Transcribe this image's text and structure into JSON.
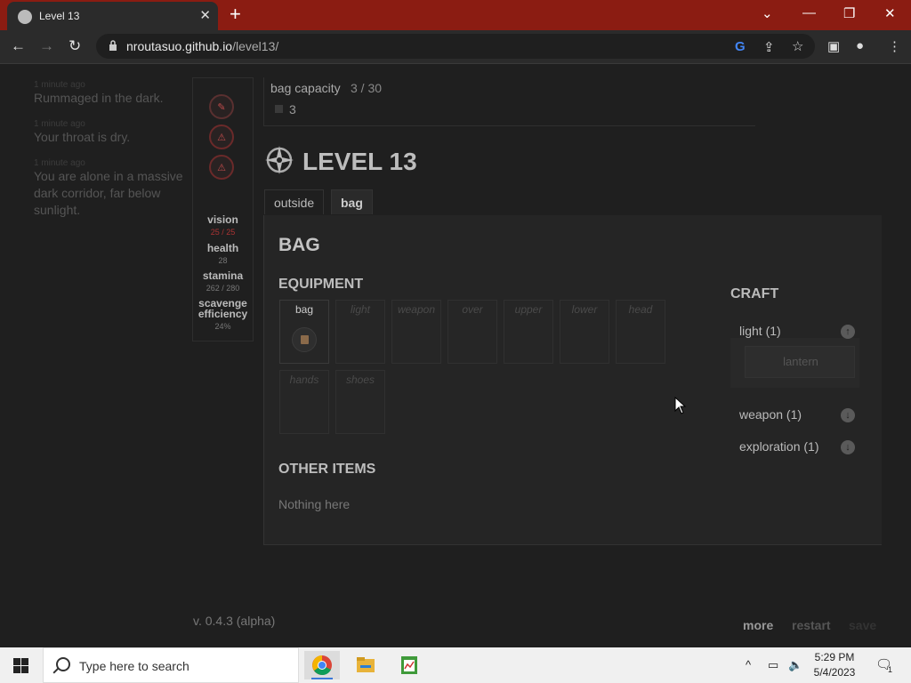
{
  "browser": {
    "tab_title": "Level 13",
    "url_domain": "nroutasuo.github.io",
    "url_path": "/level13/"
  },
  "log": [
    {
      "time": "1 minute ago",
      "message": "Rummaged in the dark."
    },
    {
      "time": "1 minute ago",
      "message": "Your throat is dry."
    },
    {
      "time": "1 minute ago",
      "message": "You are alone in a massive dark corridor, far below sunlight."
    }
  ],
  "stats": {
    "vision_label": "vision",
    "vision_value": "25 / 25",
    "health_label": "health",
    "health_value": "28",
    "stamina_label": "stamina",
    "stamina_value": "262 / 280",
    "scavenge_label": "scavenge efficiency",
    "scavenge_value": "24%"
  },
  "bag_capacity": {
    "label": "bag capacity",
    "value": "3 / 30",
    "count": "3"
  },
  "level_title": "LEVEL 13",
  "tabs": {
    "outside": "outside",
    "bag": "bag"
  },
  "bag_panel": {
    "heading": "BAG",
    "equipment_heading": "EQUIPMENT",
    "slots": [
      "bag",
      "light",
      "weapon",
      "over",
      "upper",
      "lower",
      "head",
      "hands",
      "shoes"
    ],
    "other_items_heading": "OTHER ITEMS",
    "other_items_empty": "Nothing here"
  },
  "craft": {
    "heading": "CRAFT",
    "categories": [
      "light (1)",
      "weapon (1)",
      "exploration (1)"
    ],
    "recipe": "lantern"
  },
  "footer": {
    "version": "v. 0.4.3 (alpha)",
    "more": "more",
    "restart": "restart",
    "save": "save"
  },
  "taskbar": {
    "search_placeholder": "Type here to search",
    "time": "5:29 PM",
    "date": "5/4/2023",
    "notification_count": "1"
  },
  "colors": {
    "tab_strip": "#8b1c12",
    "page_bg": "#1f1f1f",
    "panel_bg": "#252525",
    "warning_red": "#c04c4c"
  }
}
